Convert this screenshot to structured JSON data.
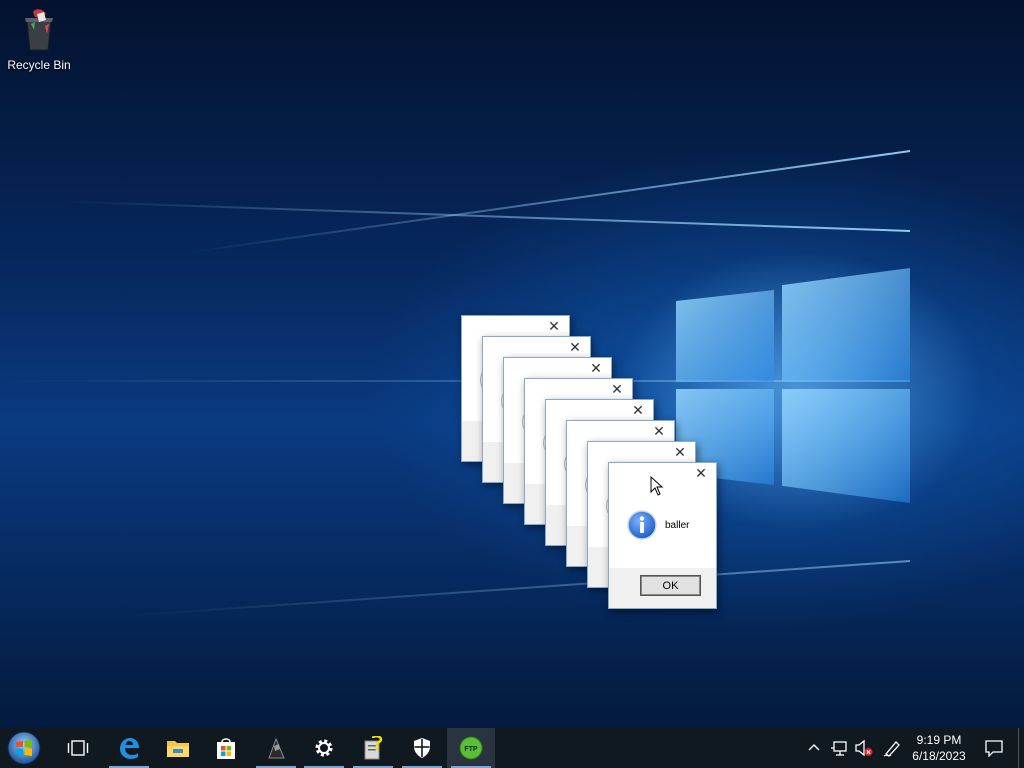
{
  "desktop": {
    "icons": [
      {
        "name": "recycle-bin",
        "label": "Recycle Bin"
      }
    ]
  },
  "dialogs": {
    "stacked_count": 7,
    "front": {
      "message": "baller",
      "ok_label": "OK",
      "icon": "information-icon",
      "close_glyph": "✕"
    }
  },
  "taskbar": {
    "items": [
      {
        "name": "start",
        "icon": "windows-start-orb"
      },
      {
        "name": "task-view",
        "icon": "task-view-icon"
      },
      {
        "name": "edge",
        "icon": "edge-icon"
      },
      {
        "name": "file-explorer",
        "icon": "folder-icon"
      },
      {
        "name": "store",
        "icon": "store-bag-icon"
      },
      {
        "name": "app-dark",
        "icon": "dark-app-icon"
      },
      {
        "name": "settings",
        "icon": "gear-icon"
      },
      {
        "name": "help",
        "icon": "help-file-icon"
      },
      {
        "name": "security",
        "icon": "shield-icon"
      },
      {
        "name": "ftp",
        "icon": "ftp-icon",
        "label": "FTP"
      }
    ],
    "tray": {
      "chevron": "^",
      "time": "9:19 PM",
      "date": "6/18/2023"
    }
  },
  "colors": {
    "taskbar_bg": "#101820",
    "accent_underline": "#7aa7d8",
    "info_blue": "#1f5fc7"
  }
}
